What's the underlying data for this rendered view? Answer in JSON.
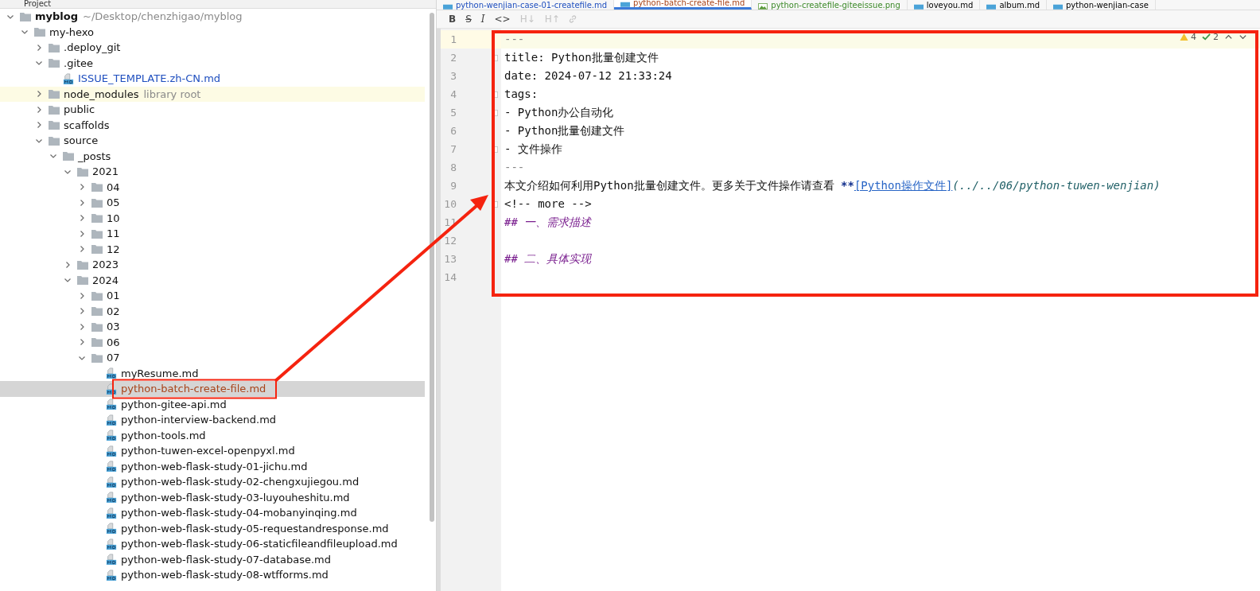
{
  "project_panel": {
    "title": "Project"
  },
  "tree": [
    {
      "name": "myblog",
      "kind": "root",
      "hint": "~/Desktop/chenzhigao/myblog",
      "expanded": true,
      "selected": false,
      "highlighted": false,
      "children": [
        {
          "name": "my-hexo",
          "kind": "folder",
          "expanded": true,
          "selected": false,
          "highlighted": false,
          "children": [
            {
              "name": ".deploy_git",
              "kind": "folder",
              "expanded": false,
              "selected": false,
              "highlighted": false
            },
            {
              "name": ".gitee",
              "kind": "folder",
              "expanded": true,
              "selected": false,
              "highlighted": false,
              "children": [
                {
                  "name": "ISSUE_TEMPLATE.zh-CN.md",
                  "kind": "file",
                  "color": "#1f4fbf",
                  "selected": false,
                  "highlighted": false
                }
              ]
            },
            {
              "name": "node_modules",
              "kind": "folder",
              "hint": "library root",
              "expanded": false,
              "selected": false,
              "highlighted": true
            },
            {
              "name": "public",
              "kind": "folder",
              "expanded": false,
              "selected": false,
              "highlighted": false
            },
            {
              "name": "scaffolds",
              "kind": "folder",
              "expanded": false,
              "selected": false,
              "highlighted": false
            },
            {
              "name": "source",
              "kind": "folder",
              "expanded": true,
              "selected": false,
              "highlighted": false,
              "children": [
                {
                  "name": "_posts",
                  "kind": "folder",
                  "expanded": true,
                  "selected": false,
                  "highlighted": false,
                  "children": [
                    {
                      "name": "2021",
                      "kind": "folder",
                      "expanded": true,
                      "selected": false,
                      "highlighted": false,
                      "children": [
                        {
                          "name": "04",
                          "kind": "folder",
                          "expanded": false,
                          "selected": false,
                          "highlighted": false
                        },
                        {
                          "name": "05",
                          "kind": "folder",
                          "expanded": false,
                          "selected": false,
                          "highlighted": false
                        },
                        {
                          "name": "10",
                          "kind": "folder",
                          "expanded": false,
                          "selected": false,
                          "highlighted": false
                        },
                        {
                          "name": "11",
                          "kind": "folder",
                          "expanded": false,
                          "selected": false,
                          "highlighted": false
                        },
                        {
                          "name": "12",
                          "kind": "folder",
                          "expanded": false,
                          "selected": false,
                          "highlighted": false
                        }
                      ]
                    },
                    {
                      "name": "2023",
                      "kind": "folder",
                      "expanded": false,
                      "selected": false,
                      "highlighted": false
                    },
                    {
                      "name": "2024",
                      "kind": "folder",
                      "expanded": true,
                      "selected": false,
                      "highlighted": false,
                      "children": [
                        {
                          "name": "01",
                          "kind": "folder",
                          "expanded": false,
                          "selected": false,
                          "highlighted": false
                        },
                        {
                          "name": "02",
                          "kind": "folder",
                          "expanded": false,
                          "selected": false,
                          "highlighted": false
                        },
                        {
                          "name": "03",
                          "kind": "folder",
                          "expanded": false,
                          "selected": false,
                          "highlighted": false
                        },
                        {
                          "name": "06",
                          "kind": "folder",
                          "expanded": false,
                          "selected": false,
                          "highlighted": false
                        },
                        {
                          "name": "07",
                          "kind": "folder",
                          "expanded": true,
                          "selected": false,
                          "highlighted": false,
                          "children": [
                            {
                              "name": "myResume.md",
                              "kind": "file",
                              "selected": false,
                              "highlighted": false
                            },
                            {
                              "name": "python-batch-create-file.md",
                              "kind": "file",
                              "color": "#a8441a",
                              "selected": true,
                              "highlighted": false
                            },
                            {
                              "name": "python-gitee-api.md",
                              "kind": "file",
                              "selected": false,
                              "highlighted": false
                            },
                            {
                              "name": "python-interview-backend.md",
                              "kind": "file",
                              "selected": false,
                              "highlighted": false
                            },
                            {
                              "name": "python-tools.md",
                              "kind": "file",
                              "selected": false,
                              "highlighted": false
                            },
                            {
                              "name": "python-tuwen-excel-openpyxl.md",
                              "kind": "file",
                              "selected": false,
                              "highlighted": false
                            },
                            {
                              "name": "python-web-flask-study-01-jichu.md",
                              "kind": "file",
                              "selected": false,
                              "highlighted": false
                            },
                            {
                              "name": "python-web-flask-study-02-chengxujiegou.md",
                              "kind": "file",
                              "selected": false,
                              "highlighted": false
                            },
                            {
                              "name": "python-web-flask-study-03-luyouheshitu.md",
                              "kind": "file",
                              "selected": false,
                              "highlighted": false
                            },
                            {
                              "name": "python-web-flask-study-04-mobanyinqing.md",
                              "kind": "file",
                              "selected": false,
                              "highlighted": false
                            },
                            {
                              "name": "python-web-flask-study-05-requestandresponse.md",
                              "kind": "file",
                              "selected": false,
                              "highlighted": false
                            },
                            {
                              "name": "python-web-flask-study-06-staticfileandfileupload.md",
                              "kind": "file",
                              "selected": false,
                              "highlighted": false
                            },
                            {
                              "name": "python-web-flask-study-07-database.md",
                              "kind": "file",
                              "selected": false,
                              "highlighted": false
                            },
                            {
                              "name": "python-web-flask-study-08-wtfforms.md",
                              "kind": "file",
                              "selected": false,
                              "highlighted": false
                            }
                          ]
                        }
                      ]
                    }
                  ]
                }
              ]
            }
          ]
        }
      ]
    }
  ],
  "editor_tabs": [
    {
      "label": "python-wenjian-case-01-createfile.md",
      "kind": "md",
      "color": "#1f4fbf",
      "selected": false
    },
    {
      "label": "python-batch-create-file.md",
      "kind": "md",
      "color": "#a8441a",
      "selected": true
    },
    {
      "label": "python-createfile-giteeissue.png",
      "kind": "image",
      "color": "#3d8a2a",
      "selected": false
    },
    {
      "label": "loveyou.md",
      "kind": "md",
      "selected": false
    },
    {
      "label": "album.md",
      "kind": "md",
      "selected": false
    },
    {
      "label": "python-wenjian-case",
      "kind": "md",
      "selected": false
    }
  ],
  "toolbar": [
    {
      "kind": "bold",
      "label": "B",
      "disabled": false
    },
    {
      "kind": "strike",
      "label": "S",
      "disabled": false
    },
    {
      "kind": "italic",
      "label": "I",
      "disabled": false
    },
    {
      "kind": "code",
      "label": "<>",
      "disabled": false
    },
    {
      "kind": "heading",
      "label": "H↓",
      "disabled": true
    },
    {
      "kind": "heading",
      "label": "H↑",
      "disabled": true
    },
    {
      "kind": "link",
      "disabled": true
    }
  ],
  "inspections": {
    "warnings": "4",
    "typos": "2"
  },
  "lines": [
    {
      "number": "1",
      "current": true,
      "fold": false,
      "segments": [
        {
          "kind": "meta",
          "text": "---"
        }
      ]
    },
    {
      "number": "2",
      "current": false,
      "fold": true,
      "segments": [
        {
          "kind": "plain",
          "text": "title: Python批量创建文件"
        }
      ]
    },
    {
      "number": "3",
      "current": false,
      "fold": false,
      "segments": [
        {
          "kind": "plain",
          "text": "date: 2024-07-12 21:33:24"
        }
      ]
    },
    {
      "number": "4",
      "current": false,
      "fold": true,
      "segments": [
        {
          "kind": "plain",
          "text": "tags:"
        }
      ]
    },
    {
      "number": "5",
      "current": false,
      "fold": true,
      "segments": [
        {
          "kind": "plain",
          "text": "- Python办公自动化"
        }
      ]
    },
    {
      "number": "6",
      "current": false,
      "fold": false,
      "segments": [
        {
          "kind": "plain",
          "text": "- Python批量创建文件"
        }
      ]
    },
    {
      "number": "7",
      "current": false,
      "fold": true,
      "segments": [
        {
          "kind": "plain",
          "text": "- 文件操作"
        }
      ]
    },
    {
      "number": "8",
      "current": false,
      "fold": false,
      "segments": [
        {
          "kind": "meta",
          "text": "---"
        }
      ]
    },
    {
      "number": "9",
      "current": false,
      "fold": false,
      "segments": [
        {
          "kind": "plain",
          "text": "本文介绍如何利用Python批量创建文件。更多关于文件操作请查看 "
        },
        {
          "kind": "emphasis",
          "text": "**"
        },
        {
          "kind": "link",
          "text": "[Python操作文件]"
        },
        {
          "kind": "url",
          "text": "(../../06/python-tuwen-wenjian)"
        }
      ]
    },
    {
      "number": "10",
      "current": false,
      "fold": true,
      "segments": [
        {
          "kind": "plain",
          "text": "<!-- more -->"
        }
      ]
    },
    {
      "number": "11",
      "current": false,
      "fold": false,
      "segments": [
        {
          "kind": "heading",
          "text": "## 一、需求描述"
        }
      ]
    },
    {
      "number": "12",
      "current": false,
      "fold": false
    },
    {
      "number": "13",
      "current": false,
      "fold": false,
      "segments": [
        {
          "kind": "heading",
          "text": "## 二、具体实现"
        }
      ]
    },
    {
      "number": "14",
      "current": false,
      "fold": false
    }
  ]
}
